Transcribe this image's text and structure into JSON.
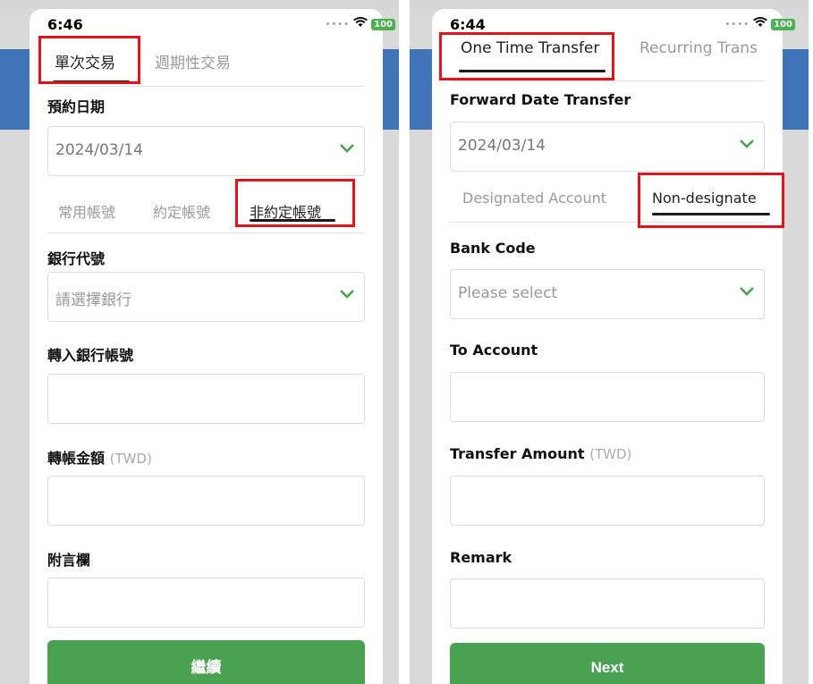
{
  "left": {
    "status": {
      "time": "6:46",
      "battery": "100"
    },
    "tabs": [
      "單次交易",
      "週期性交易"
    ],
    "date_label": "預約日期",
    "date_value": "2024/03/14",
    "subtabs": [
      "常用帳號",
      "約定帳號",
      "非約定帳號"
    ],
    "bank_code_label": "銀行代號",
    "bank_code_placeholder": "請選擇銀行",
    "to_account_label": "轉入銀行帳號",
    "amount_label": "轉帳金額",
    "amount_unit": "(TWD)",
    "remark_label": "附言欄",
    "button": "繼續"
  },
  "right": {
    "status": {
      "time": "6:44",
      "battery": "100"
    },
    "tabs": [
      "One Time Transfer",
      "Recurring Trans"
    ],
    "date_label": "Forward Date Transfer",
    "date_value": "2024/03/14",
    "subtabs": [
      "Designated Account",
      "Non-designate"
    ],
    "bank_code_label": "Bank Code",
    "bank_code_placeholder": "Please select",
    "to_account_label": "To Account",
    "amount_label": "Transfer Amount",
    "amount_unit": "(TWD)",
    "remark_label": "Remark",
    "button": "Next"
  },
  "colors": {
    "accent_green": "#4aa152",
    "highlight_red": "#e0141a",
    "band_blue": "#3f74b8"
  }
}
